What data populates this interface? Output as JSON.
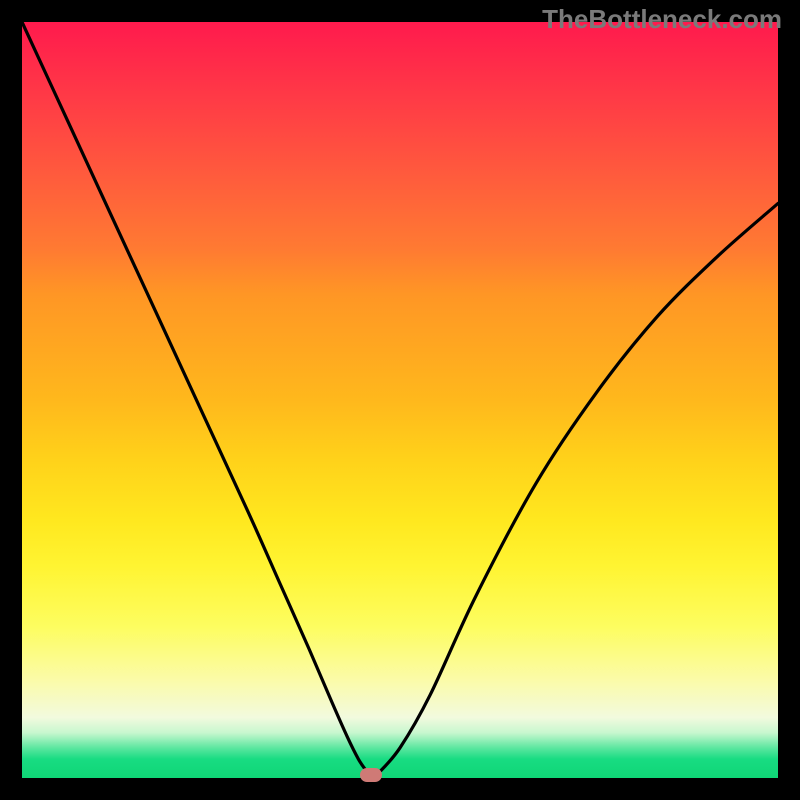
{
  "watermark": "TheBottleneck.com",
  "chart_data": {
    "type": "line",
    "title": "",
    "xlabel": "",
    "ylabel": "",
    "xlim": [
      0,
      1
    ],
    "ylim": [
      0,
      1
    ],
    "note": "Axes are unlabeled; values are normalized to the visible plot area where x runs left→right 0–1 and y is the V-curve height 0 at the dip and 1 at the top.",
    "series": [
      {
        "name": "bottleneck-curve",
        "x": [
          0.0,
          0.06,
          0.12,
          0.18,
          0.24,
          0.3,
          0.34,
          0.38,
          0.41,
          0.43,
          0.445,
          0.455,
          0.462,
          0.47,
          0.5,
          0.54,
          0.6,
          0.68,
          0.76,
          0.84,
          0.92,
          1.0
        ],
        "y": [
          1.0,
          0.87,
          0.74,
          0.61,
          0.48,
          0.35,
          0.26,
          0.17,
          0.1,
          0.055,
          0.025,
          0.01,
          0.0,
          0.005,
          0.04,
          0.11,
          0.24,
          0.39,
          0.51,
          0.61,
          0.69,
          0.76
        ]
      }
    ],
    "dip_marker": {
      "x": 0.462,
      "y": 0.0
    },
    "gradient_stops": [
      {
        "pos": 0.0,
        "color": "#ff1a4d"
      },
      {
        "pos": 0.5,
        "color": "#ffb81c"
      },
      {
        "pos": 0.8,
        "color": "#fdfd60"
      },
      {
        "pos": 0.96,
        "color": "#5de7a0"
      },
      {
        "pos": 1.0,
        "color": "#0fd676"
      }
    ]
  }
}
